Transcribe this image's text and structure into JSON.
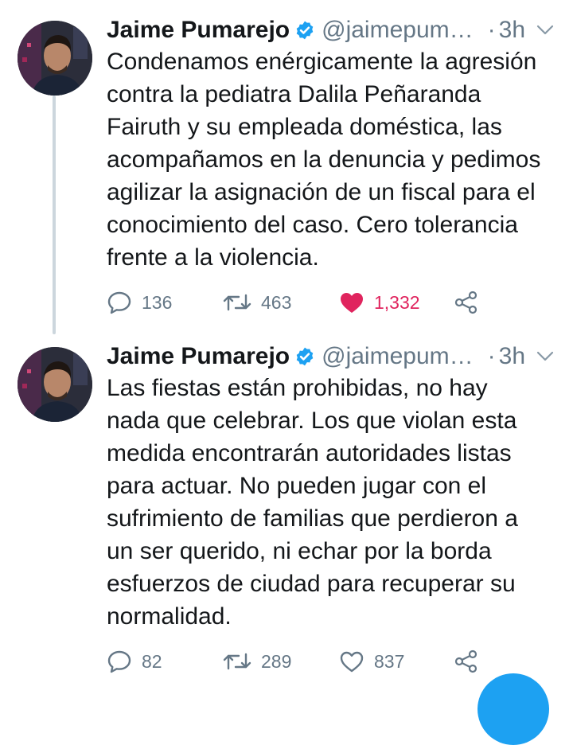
{
  "colors": {
    "accent": "#1da1f2",
    "like": "#e0245e",
    "muted": "#657786"
  },
  "tweets": [
    {
      "name": "Jaime Pumarejo",
      "handle": "@jaimepum…",
      "dot": "·",
      "time": "3h",
      "lines": [
        "Condenamos enérgicamente la agresión",
        "contra la pediatra Dalila Peñaranda",
        "Fairuth y su empleada doméstica, las",
        "acompañamos en la denuncia y pedimos",
        "agilizar la asignación de un fiscal para el",
        "conocimiento del caso. Cero tolerancia",
        "frente a la violencia."
      ],
      "replies": "136",
      "retweets": "463",
      "likes": "1,332",
      "liked": true
    },
    {
      "name": "Jaime Pumarejo",
      "handle": "@jaimepum…",
      "dot": "·",
      "time": "3h",
      "lines": [
        "Las fiestas están prohibidas, no hay",
        "nada que celebrar. Los que violan esta",
        "medida encontrarán autoridades listas",
        "para actuar. No pueden jugar con el",
        "sufrimiento de familias que perdieron a",
        "un ser querido, ni echar por la borda",
        "esfuerzos de ciudad para recuperar su",
        "normalidad."
      ],
      "replies": "82",
      "retweets": "289",
      "likes": "837",
      "liked": false
    }
  ]
}
